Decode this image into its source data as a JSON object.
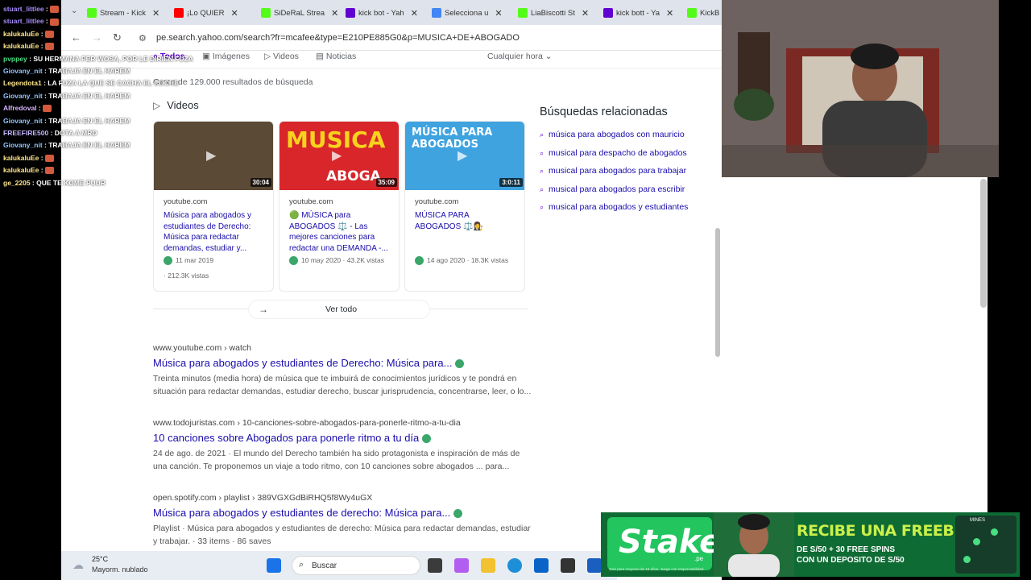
{
  "chat": [
    {
      "user": "stuart_littlee",
      "msg": "",
      "user_color": "#a78bfa",
      "emote": true
    },
    {
      "user": "stuart_littlee",
      "msg": "",
      "user_color": "#a78bfa",
      "emote": true
    },
    {
      "user": "kalukaluEe",
      "msg": "",
      "user_color": "#fde68a",
      "emote": true
    },
    {
      "user": "kalukaluEe",
      "msg": "",
      "user_color": "#fde68a",
      "emote": true
    },
    {
      "user": "pvppey",
      "msg": "SU HERMANA PER WOSA, POR LE DIRIEN FUZA",
      "user_color": "#4ade80",
      "emote": false
    },
    {
      "user": "Giovany_nit",
      "msg": "TRABAJA EN EL HAREM",
      "user_color": "#93c5fd",
      "emote": false
    },
    {
      "user": "Legendota1",
      "msg": "LA FUZA LA QUE SE CACHA EL COCHE",
      "user_color": "#fde68a",
      "emote": false
    },
    {
      "user": "Giovany_nit",
      "msg": "TRABAJA EN EL HAREM",
      "user_color": "#93c5fd",
      "emote": false
    },
    {
      "user": "Alfredoval",
      "msg": "",
      "user_color": "#d8b4fe",
      "emote": true
    },
    {
      "user": "Giovany_nit",
      "msg": "TRABAJA EN EL HAREM",
      "user_color": "#93c5fd",
      "emote": false
    },
    {
      "user": "FREEFIRE500",
      "msg": "DOTA A MRD",
      "user_color": "#c4b5fd",
      "emote": false
    },
    {
      "user": "Giovany_nit",
      "msg": "TRABAJA EN EL HAREM",
      "user_color": "#93c5fd",
      "emote": false
    },
    {
      "user": "kalukaluEe",
      "msg": "",
      "user_color": "#fde68a",
      "emote": true
    },
    {
      "user": "kalukaluEe",
      "msg": "",
      "user_color": "#fde68a",
      "emote": true
    },
    {
      "user": "ge_2205",
      "msg": "QUE TE KOME PUUR",
      "user_color": "#fde68a",
      "emote": false
    }
  ],
  "tabs": [
    {
      "label": "Stream - Kick",
      "fav_color": "#53fc18"
    },
    {
      "label": "¡Lo QUIER",
      "fav_color": "#ff0000"
    },
    {
      "label": "SiDeRaL Strea",
      "fav_color": "#53fc18"
    },
    {
      "label": "kick bot - Yah",
      "fav_color": "#6001d2"
    },
    {
      "label": "Selecciona u",
      "fav_color": "#4285f4"
    },
    {
      "label": "LiaBiscotti St",
      "fav_color": "#53fc18"
    },
    {
      "label": "kick bott - Ya",
      "fav_color": "#6001d2"
    },
    {
      "label": "KickB",
      "fav_color": "#53fc18"
    }
  ],
  "address": {
    "url": "pe.search.yahoo.com/search?fr=mcafee&type=E210PE885G0&p=MUSICA+DE+ABOGADO"
  },
  "filters": {
    "todos": "Todos",
    "imagenes": "Imágenes",
    "videos": "Videos",
    "noticias": "Noticias",
    "time": "Cualquier hora"
  },
  "results_count": "Cerca de 129.000 resultados de búsqueda",
  "videos_title": "Videos",
  "videos": [
    {
      "duration": "30:04",
      "source": "youtube.com",
      "title": "Música para abogados y estudiantes de Derecho: Música para redactar demandas, estudiar y...",
      "date": "11 mar 2019",
      "views": "· 212.3K vistas",
      "thumb_color": "#5b4a36"
    },
    {
      "duration": "35:09",
      "source": "youtube.com",
      "title": "🟢 MÚSICA para ABOGADOS ⚖️ - Las mejores canciones para redactar una DEMANDA -...",
      "date": "10 may 2020 · 43.2K vistas",
      "views": "",
      "thumb_color": "#d8262b",
      "thumb_text": "MUSICA",
      "thumb_text2": "ABOGA"
    },
    {
      "duration": "3:0:11",
      "source": "youtube.com",
      "title": "MÚSICA PARA ABOGADOS ⚖️👩‍⚖️",
      "date": "14 ago 2020 · 18.3K vistas",
      "views": "",
      "thumb_color": "#3fa3e0",
      "thumb_text": "MÚSICA PARA ABOGADOS"
    }
  ],
  "see_all": "Ver todo",
  "related_title": "Búsquedas relacionadas",
  "related": [
    "música para abogados con mauricio",
    "musical para despacho de abogados",
    "musical para abogados para trabajar",
    "musical para abogados para escribir",
    "musical para abogados y estudiantes"
  ],
  "results": [
    {
      "url": "www.youtube.com › watch",
      "title": "Música para abogados y estudiantes de Derecho: Música para...",
      "snippet": "Treinta minutos (media hora) de música que te imbuirá de conocimientos jurídicos y te pondrá en situación para redactar demandas, estudiar derecho, buscar jurisprudencia, concentrarse, leer, o lo..."
    },
    {
      "url": "www.todojuristas.com › 10-canciones-sobre-abogados-para-ponerle-ritmo-a-tu-dia",
      "title": "10 canciones sobre Abogados para ponerle ritmo a tu día",
      "snippet": "24 de ago. de 2021 · El mundo del Derecho también ha sido protagonista e inspiración de más de una canción. Te proponemos un viaje a todo ritmo, con 10 canciones sobre abogados ... para..."
    },
    {
      "url": "open.spotify.com › playlist › 389VGXGdBiRHQ5f8Wy4uGX",
      "title": "Música para abogados y estudiantes de derecho: Música para...",
      "snippet": "Playlist · Música para abogados y estudiantes de derecho: Música para redactar demandas, estudiar y trabajar. · 33 items · 86 saves"
    }
  ],
  "taskbar": {
    "temp": "25°C",
    "weather": "Mayorm. nublado",
    "search": "Buscar"
  },
  "ad": {
    "logo": "Stake",
    "logo_sub": ".pe",
    "headline": "RECIBE UNA FREEBET",
    "line2": "DE S/50 + 30 FREE SPINS",
    "line3": "CON UN DEPOSITO DE S/50",
    "game_title": "MINES",
    "fineprint": "Solo para mayores de 18 años. Juega con responsabilidad."
  },
  "colors": {
    "yahoo_purple": "#5f01d1",
    "link": "#1a0dab",
    "verified_green": "#3aa669",
    "stake_green": "#22c55e"
  }
}
